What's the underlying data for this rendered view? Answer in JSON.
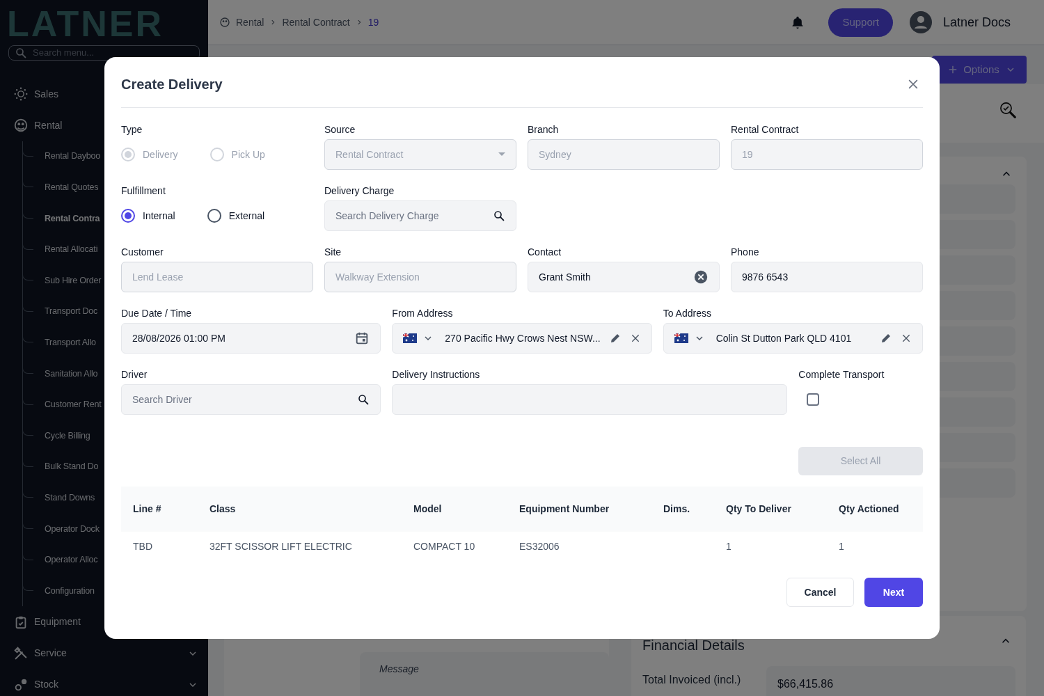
{
  "sidebar": {
    "logo": "LATNER",
    "search": {
      "placeholder": "Search menu..."
    },
    "items": [
      {
        "label": "Sales"
      },
      {
        "label": "Rental",
        "expanded": true,
        "children": [
          {
            "label": "Rental Dayboo",
            "selected": false
          },
          {
            "label": "Rental Quotes",
            "selected": false
          },
          {
            "label": "Rental Contra",
            "selected": true
          },
          {
            "label": "Rental Allocati",
            "selected": false
          },
          {
            "label": "Sub Hire Order",
            "selected": false
          },
          {
            "label": "Transport Doc",
            "selected": false
          },
          {
            "label": "Transport Allo",
            "selected": false
          },
          {
            "label": "Sanitation Allo",
            "selected": false
          },
          {
            "label": "Customer Rent",
            "selected": false
          },
          {
            "label": "Cycle Billing",
            "selected": false
          },
          {
            "label": "Bulk Stand Do",
            "selected": false
          },
          {
            "label": "Stand Downs",
            "selected": false
          },
          {
            "label": "Operator Dock",
            "selected": false
          },
          {
            "label": "Operator Alloc",
            "selected": false
          },
          {
            "label": "Configuration",
            "selected": false
          }
        ]
      },
      {
        "label": "Equipment"
      },
      {
        "label": "Service",
        "expanded": false
      },
      {
        "label": "Stock",
        "expanded": false
      }
    ]
  },
  "header": {
    "breadcrumb": [
      "Rental",
      "Rental Contract",
      "19"
    ],
    "support": "Support",
    "user": "Latner Docs"
  },
  "page": {
    "options_button": "Options",
    "message": {
      "placeholder": "Message"
    },
    "financial": {
      "title": "Financial Details",
      "label": "Total Invoiced (incl.)",
      "value": "$66,415.86"
    }
  },
  "modal": {
    "title": "Create Delivery",
    "type": {
      "label": "Type",
      "disabled": true,
      "options": [
        {
          "label": "Delivery",
          "selected": true
        },
        {
          "label": "Pick Up",
          "selected": false
        }
      ]
    },
    "source": {
      "label": "Source",
      "value": "Rental Contract",
      "disabled": true
    },
    "branch": {
      "label": "Branch",
      "value": "Sydney",
      "disabled": true
    },
    "rental_contract": {
      "label": "Rental Contract",
      "value": "19",
      "disabled": true
    },
    "fulfillment": {
      "label": "Fulfillment",
      "disabled": false,
      "options": [
        {
          "label": "Internal",
          "selected": true
        },
        {
          "label": "External",
          "selected": false
        }
      ]
    },
    "delivery_charge": {
      "label": "Delivery Charge",
      "placeholder": "Search Delivery Charge"
    },
    "customer": {
      "label": "Customer",
      "value": "Lend Lease",
      "disabled": true
    },
    "site": {
      "label": "Site",
      "value": "Walkway Extension",
      "disabled": true
    },
    "contact": {
      "label": "Contact",
      "value": "Grant Smith",
      "disabled": false
    },
    "phone": {
      "label": "Phone",
      "value": "9876 6543",
      "disabled": false
    },
    "due_date": {
      "label": "Due Date / Time",
      "value": "28/08/2026 01:00 PM"
    },
    "from_address": {
      "label": "From Address",
      "value": "270 Pacific Hwy Crows Nest NSW..."
    },
    "to_address": {
      "label": "To Address",
      "value": "Colin St Dutton Park QLD 4101"
    },
    "driver": {
      "label": "Driver",
      "placeholder": "Search Driver"
    },
    "delivery_instructions": {
      "label": "Delivery Instructions"
    },
    "complete_transport": {
      "label": "Complete Transport",
      "checked": false
    },
    "select_all": {
      "label": "Select All",
      "disabled": true
    },
    "table": {
      "columns": [
        "Line #",
        "Class",
        "Model",
        "Equipment Number",
        "Dims.",
        "Qty To Deliver",
        "Qty Actioned"
      ],
      "rows": [
        [
          "TBD",
          "32FT SCISSOR LIFT ELECTRIC",
          "COMPACT 10",
          "ES32006",
          "",
          "1",
          "1"
        ]
      ]
    },
    "cancel": "Cancel",
    "next": "Next"
  }
}
